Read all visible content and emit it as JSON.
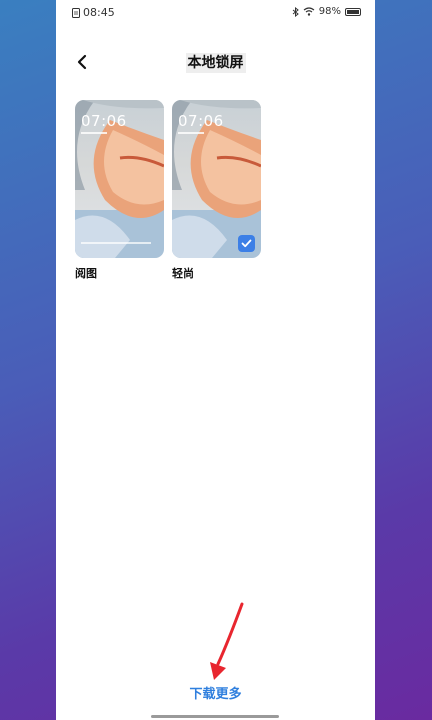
{
  "status": {
    "time": "08:45",
    "battery": "98%"
  },
  "header": {
    "title": "本地锁屏"
  },
  "themes": [
    {
      "name": "阅图",
      "clock": "07:06",
      "selected": false
    },
    {
      "name": "轻尚",
      "clock": "07:06",
      "selected": true
    }
  ],
  "footer": {
    "download_label": "下载更多"
  },
  "colors": {
    "accent": "#2f7fde",
    "check": "#3c7fe6",
    "annotation_arrow": "#e8262f"
  }
}
